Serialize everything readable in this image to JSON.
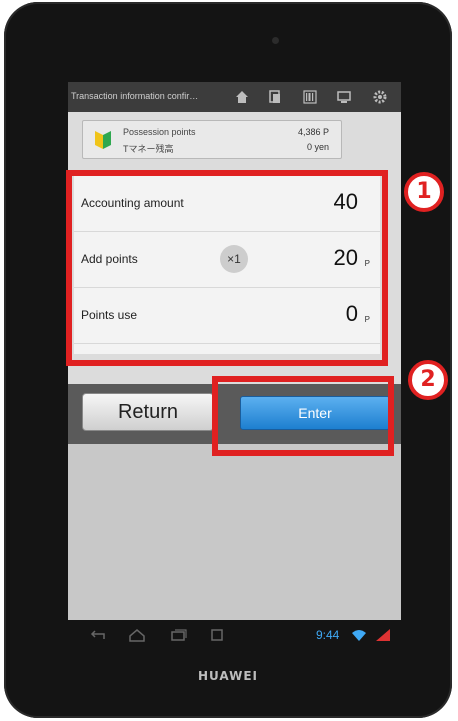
{
  "action_bar": {
    "title": "Transaction information confir…",
    "icons": [
      "home-icon",
      "copy-icon",
      "barcode-icon",
      "display-icon",
      "gear-icon"
    ]
  },
  "points_box": {
    "possession_label": "Possession points",
    "possession_value": "4,386 P",
    "money_label": "Tマネー残高",
    "money_value": "0 yen"
  },
  "panel": {
    "rows": [
      {
        "label": "Accounting amount",
        "value": "40",
        "unit": ""
      },
      {
        "label": "Add points",
        "multiplier": "×1",
        "value": "20",
        "unit": "P"
      },
      {
        "label": "Points use",
        "value": "0",
        "unit": "P"
      }
    ]
  },
  "buttons": {
    "return_label": "Return",
    "enter_label": "Enter"
  },
  "status": {
    "time": "9:44"
  },
  "device": {
    "brand": "HUAWEI"
  },
  "annotations": {
    "badge1": "1",
    "badge2": "2"
  },
  "colors": {
    "highlight": "#e02121",
    "enter_button": "#2b8ee0"
  }
}
